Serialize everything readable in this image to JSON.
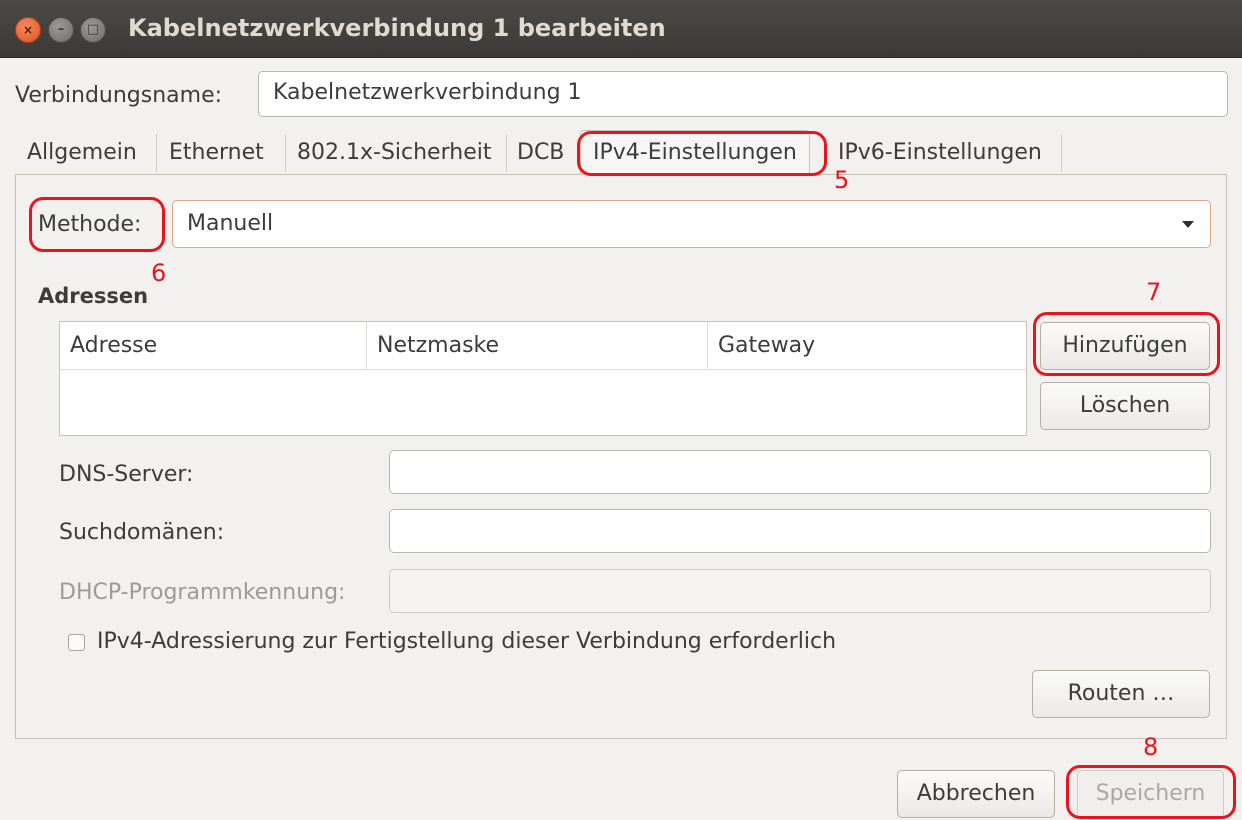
{
  "window": {
    "title": "Kabelnetzwerkverbindung 1 bearbeiten",
    "close_glyph": "×",
    "min_glyph": "–",
    "max_glyph": "□"
  },
  "connection": {
    "name_label": "Verbindungsname:",
    "name_value": "Kabelnetzwerkverbindung 1"
  },
  "tabs": [
    {
      "label": "Allgemein"
    },
    {
      "label": "Ethernet"
    },
    {
      "label": "802.1x-Sicherheit"
    },
    {
      "label": "DCB"
    },
    {
      "label": "IPv4-Einstellungen",
      "active": true
    },
    {
      "label": "IPv6-Einstellungen"
    }
  ],
  "ipv4": {
    "method_label": "Methode:",
    "method_value": "Manuell",
    "addresses_title": "Adressen",
    "columns": [
      "Adresse",
      "Netzmaske",
      "Gateway"
    ],
    "rows": [],
    "add_button": "Hinzufügen",
    "delete_button": "Löschen",
    "dns_label": "DNS-Server:",
    "dns_value": "",
    "search_label": "Suchdomänen:",
    "search_value": "",
    "dhcp_label": "DHCP-Programmkennung:",
    "dhcp_value": "",
    "require_checkbox_label": "IPv4-Adressierung zur Fertigstellung dieser Verbindung erforderlich",
    "require_checked": false,
    "routes_button": "Routen …"
  },
  "footer": {
    "cancel_button": "Abbrechen",
    "save_button": "Speichern"
  },
  "annotations": {
    "color": "#e8161a",
    "labels": [
      "5",
      "6",
      "7",
      "8"
    ]
  }
}
